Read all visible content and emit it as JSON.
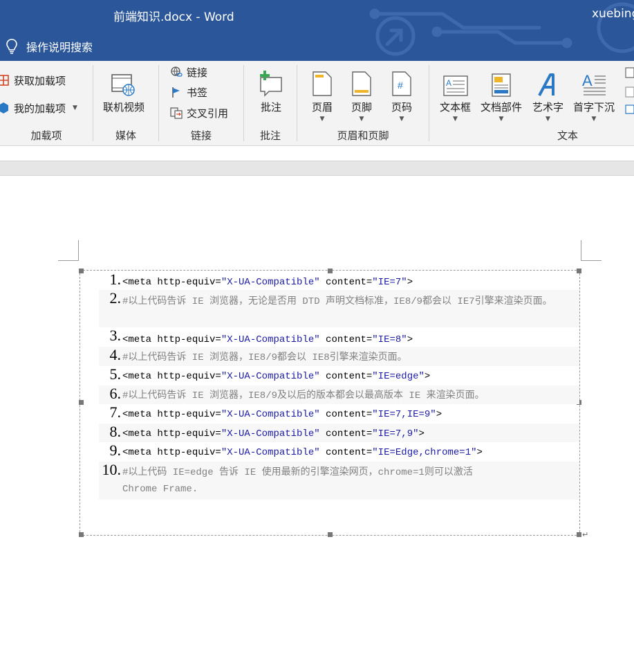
{
  "window": {
    "title": "前端知识.docx  -  Word",
    "user": "xuebing"
  },
  "tellme": {
    "label": "操作说明搜索"
  },
  "ribbon": {
    "addins": {
      "get": "获取加载项",
      "mine": "我的加载项",
      "label": "加载项"
    },
    "media": {
      "online_video": "联机视频",
      "label": "媒体"
    },
    "links": {
      "link": "链接",
      "bookmark": "书签",
      "crossref": "交叉引用",
      "label": "链接"
    },
    "comments": {
      "comment": "批注",
      "label": "批注"
    },
    "headerfooter": {
      "header": "页眉",
      "footer": "页脚",
      "pagenum": "页码",
      "label": "页眉和页脚"
    },
    "text": {
      "textbox": "文本框",
      "quickparts": "文档部件",
      "wordart": "艺术字",
      "dropcap": "首字下沉",
      "label": "文本"
    }
  },
  "code_lines": [
    {
      "n": "1.",
      "pre": "<meta http-equiv=",
      "a": "\"X-UA-Compatible\"",
      "mid": " content=",
      "b": "\"IE=7\"",
      "post": ">"
    },
    {
      "n": "2.",
      "comment": "#以上代码告诉 IE 浏览器，无论是否用 DTD 声明文档标准，IE8/9都会以 IE7引擎来渲染页面。"
    },
    {
      "n": "3.",
      "pre": "<meta http-equiv=",
      "a": "\"X-UA-Compatible\"",
      "mid": " content=",
      "b": "\"IE=8\"",
      "post": ">"
    },
    {
      "n": "4.",
      "comment": "#以上代码告诉 IE 浏览器，IE8/9都会以 IE8引擎来渲染页面。"
    },
    {
      "n": "5.",
      "pre": "<meta http-equiv=",
      "a": "\"X-UA-Compatible\"",
      "mid": " content=",
      "b": "\"IE=edge\"",
      "post": ">"
    },
    {
      "n": "6.",
      "comment": "#以上代码告诉 IE 浏览器，IE8/9及以后的版本都会以最高版本 IE 来渲染页面。"
    },
    {
      "n": "7.",
      "pre": "<meta http-equiv=",
      "a": "\"X-UA-Compatible\"",
      "mid": " content=",
      "b": "\"IE=7,IE=9\"",
      "post": ">"
    },
    {
      "n": "8.",
      "pre": "<meta http-equiv=",
      "a": "\"X-UA-Compatible\"",
      "mid": " content=",
      "b": "\"IE=7,9\"",
      "post": ">"
    },
    {
      "n": "9.",
      "pre": "<meta http-equiv=",
      "a": "\"X-UA-Compatible\"",
      "mid": " content=",
      "b": "\"IE=Edge,chrome=1\"",
      "post": ">"
    },
    {
      "n": "10.",
      "comment": "#以上代码 IE=edge 告诉 IE 使用最新的引擎渲染网页，chrome=1则可以激活 Chrome Frame."
    }
  ],
  "colors": {
    "titlebar": "#2b579a",
    "string": "#1a1aa6",
    "comment": "#808080"
  },
  "icons": [
    "lightbulb-icon",
    "store-icon",
    "addin-icon",
    "online-video-icon",
    "link-icon",
    "bookmark-icon",
    "crossref-icon",
    "comment-icon",
    "header-icon",
    "footer-icon",
    "pagenum-icon",
    "textbox-icon",
    "quickparts-icon",
    "wordart-icon",
    "dropcap-icon"
  ]
}
